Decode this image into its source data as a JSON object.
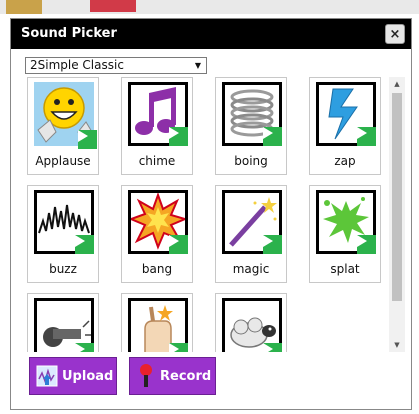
{
  "dialog": {
    "title": "Sound Picker",
    "close_label": "×"
  },
  "library_select": {
    "value": "2Simple Classic",
    "arrow": "▼"
  },
  "sounds": [
    {
      "label": "Applause",
      "icon": "smiley-clapping-icon"
    },
    {
      "label": "chime",
      "icon": "music-note-icon"
    },
    {
      "label": "boing",
      "icon": "spring-icon"
    },
    {
      "label": "zap",
      "icon": "lightning-icon"
    },
    {
      "label": "buzz",
      "icon": "zigzag-icon"
    },
    {
      "label": "bang",
      "icon": "explosion-icon"
    },
    {
      "label": "magic",
      "icon": "magic-wand-icon"
    },
    {
      "label": "splat",
      "icon": "splat-icon"
    },
    {
      "label": "",
      "icon": "whistle-icon"
    },
    {
      "label": "",
      "icon": "finger-snap-icon"
    },
    {
      "label": "",
      "icon": "sheep-icon"
    }
  ],
  "buttons": {
    "upload_label": "Upload",
    "record_label": "Record"
  },
  "colors": {
    "titlebar": "#000000",
    "button": "#9933cc",
    "play_badge": "#2bb24c"
  }
}
